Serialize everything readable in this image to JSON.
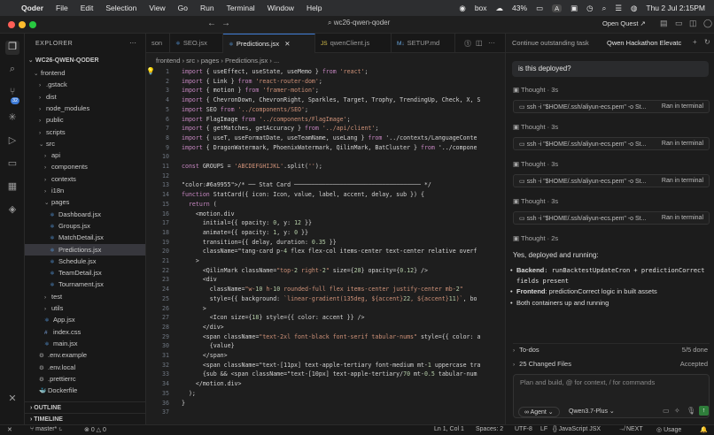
{
  "menubar": {
    "app": "Qoder",
    "items": [
      "File",
      "Edit",
      "Selection",
      "View",
      "Go",
      "Run",
      "Terminal",
      "Window",
      "Help"
    ],
    "box": "box",
    "battery": "43%",
    "input_source": "A",
    "clock": "Thu 2 Jul  2:15PM"
  },
  "titlebar": {
    "search": "wc26-qwen-qoder",
    "open_quest": "Open Quest"
  },
  "explorer": {
    "title": "EXPLORER",
    "root": "WC26-QWEN-QODER",
    "rows": [
      {
        "label": "frontend",
        "chev": "⌄",
        "indent": 1,
        "type": "folder"
      },
      {
        "label": ".gstack",
        "chev": "›",
        "indent": 2,
        "type": "folder"
      },
      {
        "label": "dist",
        "chev": "›",
        "indent": 2,
        "type": "folder"
      },
      {
        "label": "node_modules",
        "chev": "›",
        "indent": 2,
        "type": "folder"
      },
      {
        "label": "public",
        "chev": "›",
        "indent": 2,
        "type": "folder"
      },
      {
        "label": "scripts",
        "chev": "›",
        "indent": 2,
        "type": "folder"
      },
      {
        "label": "src",
        "chev": "⌄",
        "indent": 2,
        "type": "folder"
      },
      {
        "label": "api",
        "chev": "›",
        "indent": 3,
        "type": "folder"
      },
      {
        "label": "components",
        "chev": "›",
        "indent": 3,
        "type": "folder"
      },
      {
        "label": "contexts",
        "chev": "›",
        "indent": 3,
        "type": "folder"
      },
      {
        "label": "i18n",
        "chev": "›",
        "indent": 3,
        "type": "folder"
      },
      {
        "label": "pages",
        "chev": "⌄",
        "indent": 3,
        "type": "folder"
      },
      {
        "label": "Dashboard.jsx",
        "chev": "",
        "indent": 4,
        "type": "jsx"
      },
      {
        "label": "Groups.jsx",
        "chev": "",
        "indent": 4,
        "type": "jsx"
      },
      {
        "label": "MatchDetail.jsx",
        "chev": "",
        "indent": 4,
        "type": "jsx"
      },
      {
        "label": "Predictions.jsx",
        "chev": "",
        "indent": 4,
        "type": "jsx",
        "selected": true
      },
      {
        "label": "Schedule.jsx",
        "chev": "",
        "indent": 4,
        "type": "jsx"
      },
      {
        "label": "TeamDetail.jsx",
        "chev": "",
        "indent": 4,
        "type": "jsx"
      },
      {
        "label": "Tournament.jsx",
        "chev": "",
        "indent": 4,
        "type": "jsx"
      },
      {
        "label": "test",
        "chev": "›",
        "indent": 3,
        "type": "folder"
      },
      {
        "label": "utils",
        "chev": "›",
        "indent": 3,
        "type": "folder"
      },
      {
        "label": "App.jsx",
        "chev": "",
        "indent": 3,
        "type": "jsx"
      },
      {
        "label": "index.css",
        "chev": "",
        "indent": 3,
        "type": "css"
      },
      {
        "label": "main.jsx",
        "chev": "",
        "indent": 3,
        "type": "jsx"
      },
      {
        "label": ".env.example",
        "chev": "",
        "indent": 2,
        "type": "gear"
      },
      {
        "label": ".env.local",
        "chev": "",
        "indent": 2,
        "type": "gear"
      },
      {
        "label": ".prettierrc",
        "chev": "",
        "indent": 2,
        "type": "gear"
      },
      {
        "label": "Dockerfile",
        "chev": "",
        "indent": 2,
        "type": "docker"
      }
    ],
    "outline": "OUTLINE",
    "timeline": "TIMELINE"
  },
  "tabs": [
    {
      "label": "son",
      "icon": "",
      "active": false
    },
    {
      "label": "SEO.jsx",
      "icon": "jsx",
      "active": false
    },
    {
      "label": "Predictions.jsx",
      "icon": "jsx",
      "active": true
    },
    {
      "label": "qwenClient.js",
      "icon": "js",
      "active": false
    },
    {
      "label": "SETUP.md",
      "icon": "md",
      "active": false
    }
  ],
  "breadcrumb": "frontend  ›  src  ›  pages  ›  Predictions.jsx  ›  ...",
  "code_lines": [
    {
      "n": "1",
      "t": "import { useEffect, useState, useMemo } from 'react';"
    },
    {
      "n": "2",
      "t": "import { Link } from 'react-router-dom';"
    },
    {
      "n": "3",
      "t": "import { motion } from 'framer-motion';"
    },
    {
      "n": "4",
      "t": "import { ChevronDown, ChevronRight, Sparkles, Target, Trophy, TrendingUp, Check, X, S"
    },
    {
      "n": "5",
      "t": "import SEO from '../components/SEO';"
    },
    {
      "n": "6",
      "t": "import FlagImage from '../components/FlagImage';"
    },
    {
      "n": "7",
      "t": "import { getMatches, getAccuracy } from '../api/client';"
    },
    {
      "n": "8",
      "t": "import { useT, useFormatDate, useTeamName, useLang } from '../contexts/LanguageConte"
    },
    {
      "n": "9",
      "t": "import { DragonWatermark, PhoenixWatermark, QilinMark, BatCluster } from '../compone"
    },
    {
      "n": "10",
      "t": ""
    },
    {
      "n": "11",
      "t": "const GROUPS = 'ABCDEFGHIJKL'.split('');"
    },
    {
      "n": "12",
      "t": ""
    },
    {
      "n": "13",
      "t": "/* ── Stat Card ──────────────────────────────────── */"
    },
    {
      "n": "14",
      "t": "function StatCard({ icon: Icon, value, label, accent, delay, sub }) {"
    },
    {
      "n": "15",
      "t": "  return ("
    },
    {
      "n": "16",
      "t": "    <motion.div"
    },
    {
      "n": "17",
      "t": "      initial={{ opacity: 0, y: 12 }}"
    },
    {
      "n": "18",
      "t": "      animate={{ opacity: 1, y: 0 }}"
    },
    {
      "n": "19",
      "t": "      transition={{ delay, duration: 0.35 }}"
    },
    {
      "n": "20",
      "t": "      className=\"tang-card p-4 flex flex-col items-center text-center relative overf"
    },
    {
      "n": "21",
      "t": "    >"
    },
    {
      "n": "22",
      "t": "      <QilinMark className=\"top-2 right-2\" size={28} opacity={0.12} />"
    },
    {
      "n": "23",
      "t": "      <div"
    },
    {
      "n": "24",
      "t": "        className=\"w-10 h-10 rounded-full flex items-center justify-center mb-2\""
    },
    {
      "n": "25",
      "t": "        style={{ background: `linear-gradient(135deg, ${accent}22, ${accent}11)`, bo"
    },
    {
      "n": "26",
      "t": "      >"
    },
    {
      "n": "27",
      "t": "        <Icon size={18} style={{ color: accent }} />"
    },
    {
      "n": "28",
      "t": "      </div>"
    },
    {
      "n": "29",
      "t": "      <span className=\"text-2xl font-black font-serif tabular-nums\" style={{ color: a"
    },
    {
      "n": "30",
      "t": "        {value}"
    },
    {
      "n": "31",
      "t": "      </span>"
    },
    {
      "n": "32",
      "t": "      <span className=\"text-[11px] text-apple-tertiary font-medium mt-1 uppercase tra"
    },
    {
      "n": "33",
      "t": "      {sub && <span className=\"text-[10px] text-apple-tertiary/70 mt-0.5 tabular-num"
    },
    {
      "n": "34",
      "t": "    </motion.div>"
    },
    {
      "n": "35",
      "t": "  );"
    },
    {
      "n": "36",
      "t": "}"
    },
    {
      "n": "37",
      "t": ""
    }
  ],
  "right_panel": {
    "tab1": "Continue outstanding task",
    "tab2": "Qwen Hackathon Elevatc",
    "user_message": "is this deployed?",
    "thoughts": [
      "Thought · 3s",
      "Thought · 3s",
      "Thought · 3s",
      "Thought · 3s",
      "Thought · 2s"
    ],
    "command": "ssh -i \"$HOME/.ssh/aliyun-ecs.pem\" -o St...",
    "command_status": "Ran in terminal",
    "answer_intro": "Yes, deployed and running:",
    "bullets": [
      {
        "bold": "Backend",
        "text": ": runBacktestUpdateCron + predictionCorrect fields present"
      },
      {
        "bold": "Frontend",
        "text": ": predictionCorrect logic in built assets"
      },
      {
        "bold": "",
        "text": "Both containers up and running"
      }
    ],
    "todos_label": "To-dos",
    "todos_status": "5/5 done",
    "changed_label": "25 Changed Files",
    "changed_status": "Accepted",
    "input_placeholder": "Plan and build, @ for context, / for commands",
    "agent_mode": "Agent",
    "model": "Qwen3.7-Plus"
  },
  "statusbar": {
    "branch": "master*",
    "errors": "0",
    "warnings": "0",
    "position": "Ln 1, Col 1",
    "spaces": "Spaces: 2",
    "encoding": "UTF-8",
    "eol": "LF",
    "language": "JavaScript JSX",
    "next": "NEXT",
    "usage": "Usage"
  }
}
